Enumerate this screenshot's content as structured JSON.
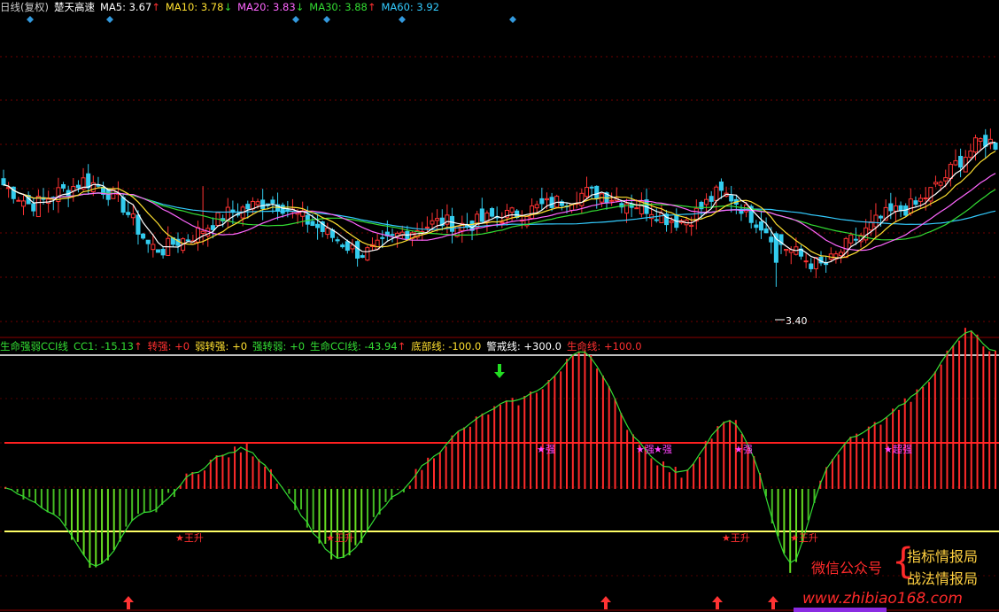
{
  "header": {
    "period": "日线(复权)",
    "stock": "楚天高速",
    "ma": [
      {
        "label": "MA5",
        "value": "3.67",
        "dir": "↑",
        "color": "#ffffff"
      },
      {
        "label": "MA10",
        "value": "3.78",
        "dir": "↓",
        "color": "#ffe030"
      },
      {
        "label": "MA20",
        "value": "3.83",
        "dir": "↓",
        "color": "#ff66ff"
      },
      {
        "label": "MA30",
        "value": "3.88",
        "dir": "↑",
        "color": "#33dd33"
      },
      {
        "label": "MA60",
        "value": "3.92",
        "dir": "",
        "color": "#33ccff"
      }
    ]
  },
  "indicator_header": {
    "name": "生命强弱CCI线",
    "items": [
      {
        "label": "CC1",
        "value": "-15.13",
        "dir": "↑",
        "color": "#33dd33"
      },
      {
        "label": "转强",
        "value": "+0",
        "dir": "",
        "color": "#ff3030"
      },
      {
        "label": "弱转强",
        "value": "+0",
        "dir": "",
        "color": "#ffe030"
      },
      {
        "label": "强转弱",
        "value": "+0",
        "dir": "",
        "color": "#33dd33"
      },
      {
        "label": "生命CCI线",
        "value": "-43.94",
        "dir": "↑",
        "color": "#33dd33"
      },
      {
        "label": "底部线",
        "value": "-100.0",
        "dir": "",
        "color": "#ffe030"
      },
      {
        "label": "警戒线",
        "value": "+300.0",
        "dir": "",
        "color": "#ffffff"
      },
      {
        "label": "生命线",
        "value": "+100.0",
        "dir": "",
        "color": "#ff3030"
      }
    ]
  },
  "colors": {
    "up": "#ff3333",
    "down": "#33ccee",
    "ma5": "#ffffff",
    "ma10": "#ffe030",
    "ma20": "#ff66ff",
    "ma30": "#33dd33",
    "ma60": "#33ccff",
    "cci_line": "#33dd33",
    "life_line": "#ff2020",
    "bottom_line": "#ffff66",
    "alert_line": "#ffffff"
  },
  "signals": {
    "strong_label": "强",
    "strong_double_label": "超强",
    "rise_label": "王升",
    "low_annotation": "3.40"
  },
  "watermark": {
    "left": "微信公众号",
    "right1": "指标情报局",
    "right2": "战法情报局",
    "url": "www.zhibiao168.com"
  },
  "chart_data": [
    {
      "type": "candlestick",
      "title": "",
      "series": [
        {
          "name": "MA5"
        },
        {
          "name": "MA10"
        },
        {
          "name": "MA20"
        },
        {
          "name": "MA30"
        },
        {
          "name": "MA60"
        }
      ],
      "close": [
        3.9,
        3.85,
        3.8,
        3.82,
        3.86,
        3.88,
        3.92,
        3.9,
        3.86,
        3.8,
        3.7,
        3.6,
        3.58,
        3.62,
        3.64,
        3.68,
        3.72,
        3.76,
        3.78,
        3.8,
        3.82,
        3.8,
        3.76,
        3.72,
        3.68,
        3.64,
        3.6,
        3.56,
        3.58,
        3.62,
        3.66,
        3.68,
        3.7,
        3.72,
        3.71,
        3.7,
        3.72,
        3.74,
        3.75,
        3.76,
        3.78,
        3.8,
        3.82,
        3.84,
        3.86,
        3.86,
        3.84,
        3.82,
        3.8,
        3.78,
        3.74,
        3.72,
        3.74,
        3.8,
        3.86,
        3.84,
        3.78,
        3.72,
        3.66,
        3.6,
        3.56,
        3.52,
        3.5,
        3.55,
        3.62,
        3.66,
        3.72,
        3.76,
        3.78,
        3.8,
        3.86,
        3.92,
        4.0,
        4.06,
        4.12,
        4.1
      ],
      "ma60_last": 3.92,
      "low_marker": 3.4
    },
    {
      "type": "bar",
      "title": "生命强弱CCI线",
      "levels": {
        "alert": 300,
        "life": 100,
        "bottom": -100
      },
      "cc1": [
        -10,
        -20,
        -30,
        -40,
        -60,
        -90,
        -130,
        -170,
        -180,
        -150,
        -100,
        -70,
        -60,
        -40,
        -10,
        20,
        40,
        60,
        70,
        80,
        90,
        70,
        40,
        0,
        -40,
        -80,
        -120,
        -160,
        -170,
        -140,
        -100,
        -60,
        -30,
        0,
        30,
        60,
        90,
        110,
        130,
        150,
        170,
        180,
        190,
        200,
        220,
        240,
        260,
        300,
        320,
        280,
        220,
        160,
        120,
        90,
        60,
        40,
        30,
        60,
        100,
        130,
        150,
        130,
        60,
        -20,
        -120,
        -200,
        -120,
        -30,
        40,
        80,
        110,
        120,
        140,
        160,
        180,
        200,
        220,
        260,
        300,
        340,
        360,
        330,
        300
      ]
    }
  ]
}
